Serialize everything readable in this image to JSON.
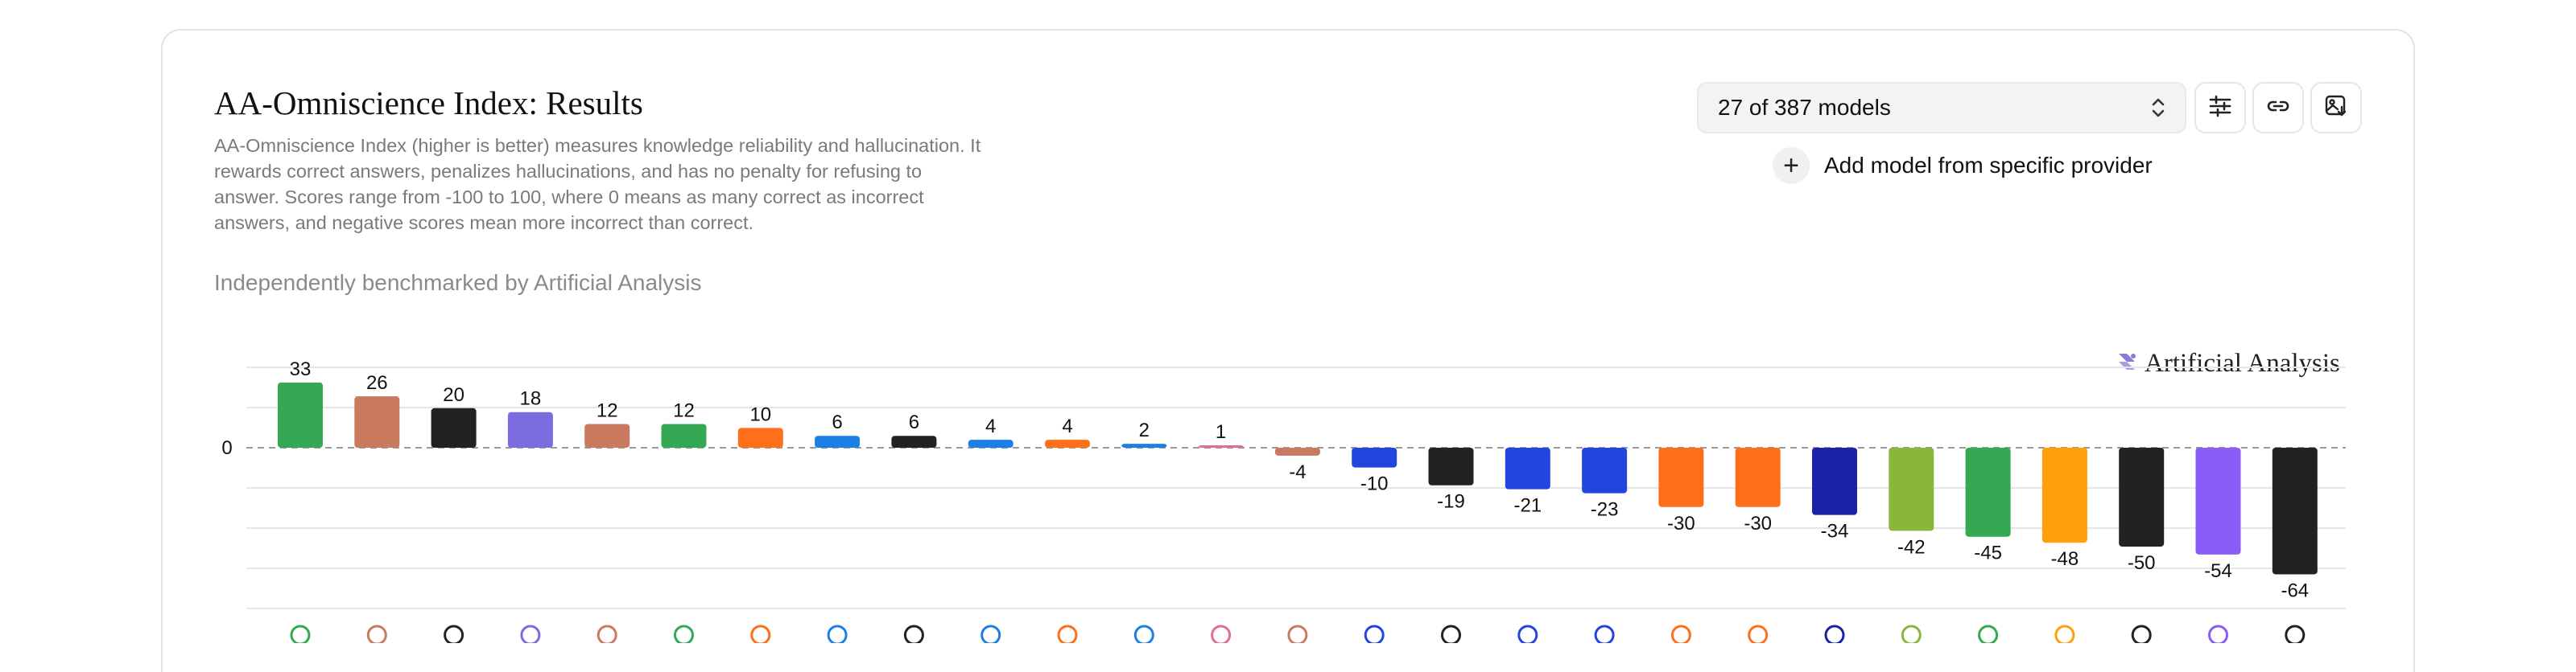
{
  "header": {
    "title": "AA-Omniscience Index: Results",
    "description": "AA-Omniscience Index (higher is better) measures knowledge reliability and hallucination. It rewards correct answers, penalizes hallucinations, and has no penalty for refusing to answer. Scores range from -100 to 100, where 0 means as many correct as incorrect answers, and negative scores mean more incorrect than correct.",
    "benchmarked_by": "Independently benchmarked by Artificial Analysis"
  },
  "controls": {
    "model_count": "27 of 387 models",
    "add_provider": "Add model from specific provider"
  },
  "watermark": "Artificial Analysis",
  "chart_data": {
    "type": "bar",
    "values": [
      33,
      26,
      20,
      18,
      12,
      12,
      10,
      6,
      6,
      4,
      4,
      2,
      1,
      -4,
      -10,
      -19,
      -21,
      -23,
      -30,
      -30,
      -34,
      -42,
      -45,
      -48,
      -50,
      -54,
      -64
    ],
    "colors": [
      "#34a853",
      "#c97a5f",
      "#222222",
      "#7b6ce0",
      "#c97a5f",
      "#34a853",
      "#ff6f1a",
      "#1a7fe6",
      "#222222",
      "#1a7fe6",
      "#ff6f1a",
      "#1a7fe6",
      "#e0708c",
      "#c97a5f",
      "#2246dd",
      "#222222",
      "#2246dd",
      "#2246dd",
      "#ff6f1a",
      "#ff6f1a",
      "#1a23a8",
      "#8ab73a",
      "#34a853",
      "#ff9f0a",
      "#222222",
      "#8b5cf6",
      "#222222"
    ],
    "provider_icons": [
      "google-icon",
      "anthropic-icon",
      "openai-icon",
      "xai-icon",
      "anthropic-icon",
      "google-icon",
      "alibaba-icon",
      "kimi-icon",
      "openai-icon",
      "meta-icon",
      "xiaomi-icon",
      "zai-icon",
      "minimax-icon",
      "anthropic-icon",
      "deepseek-icon",
      "openai-icon",
      "deepseek-icon",
      "deepseek-icon",
      "alibaba-icon",
      "mistral-icon",
      "ibm-icon",
      "nvidia-icon",
      "google-icon",
      "aws-icon",
      "openai-icon",
      "perplexity-icon",
      "openai-icon"
    ],
    "y_zero_label": "0",
    "grid": true,
    "baseline": "dashed"
  }
}
